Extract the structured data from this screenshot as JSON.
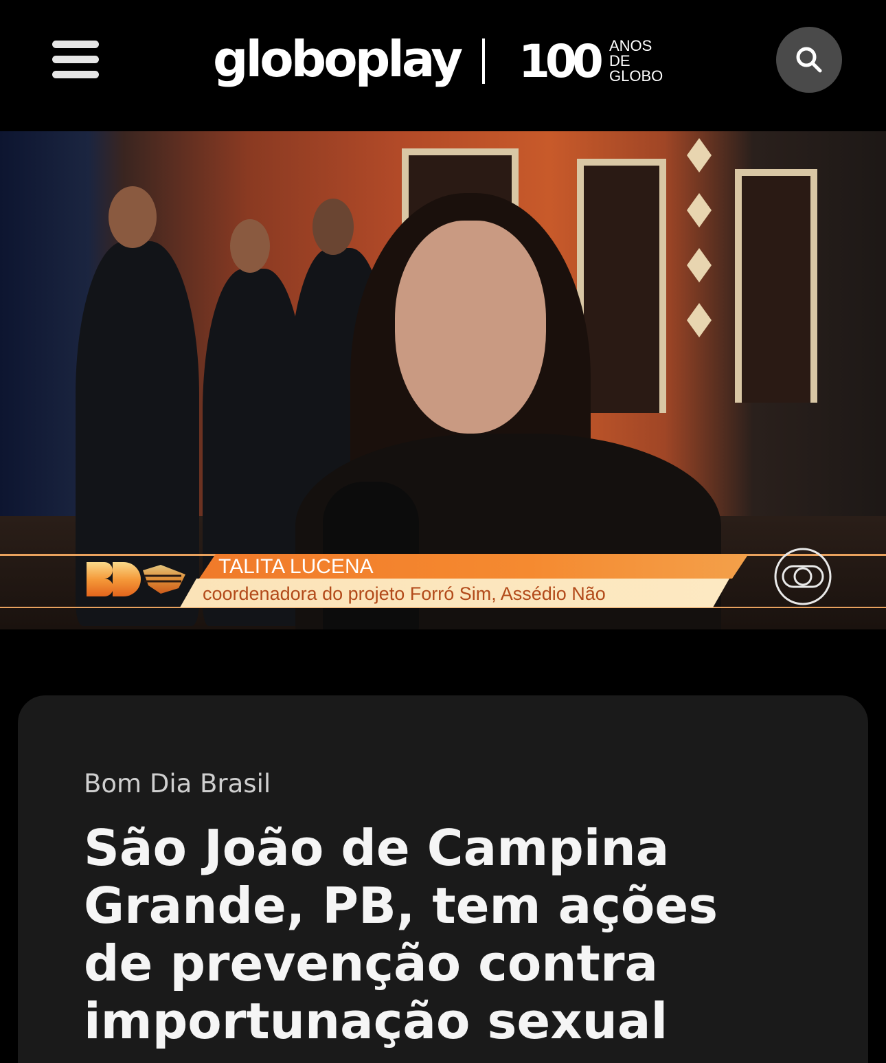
{
  "header": {
    "brand": "globoplay",
    "centenary_number": "100",
    "centenary_text": "ANOS\nDE\nGLOBO",
    "menu_icon": "hamburger-menu-icon",
    "search_icon": "search-icon"
  },
  "video": {
    "lower_third": {
      "name": "TALITA LUCENA",
      "role": "coordenadora do projeto Forró Sim, Assédio Não",
      "program_logo": "BD",
      "name_color": "#f58a30",
      "role_bg_color": "#fde9c2",
      "role_text_color": "#b24a1a"
    }
  },
  "article": {
    "program": "Bom Dia Brasil",
    "headline": "São João de Campina Grande, PB, tem ações de prevenção contra importunação sexual"
  },
  "colors": {
    "background": "#000000",
    "card": "#1a1a1a",
    "search_button": "#4a4a4a"
  }
}
